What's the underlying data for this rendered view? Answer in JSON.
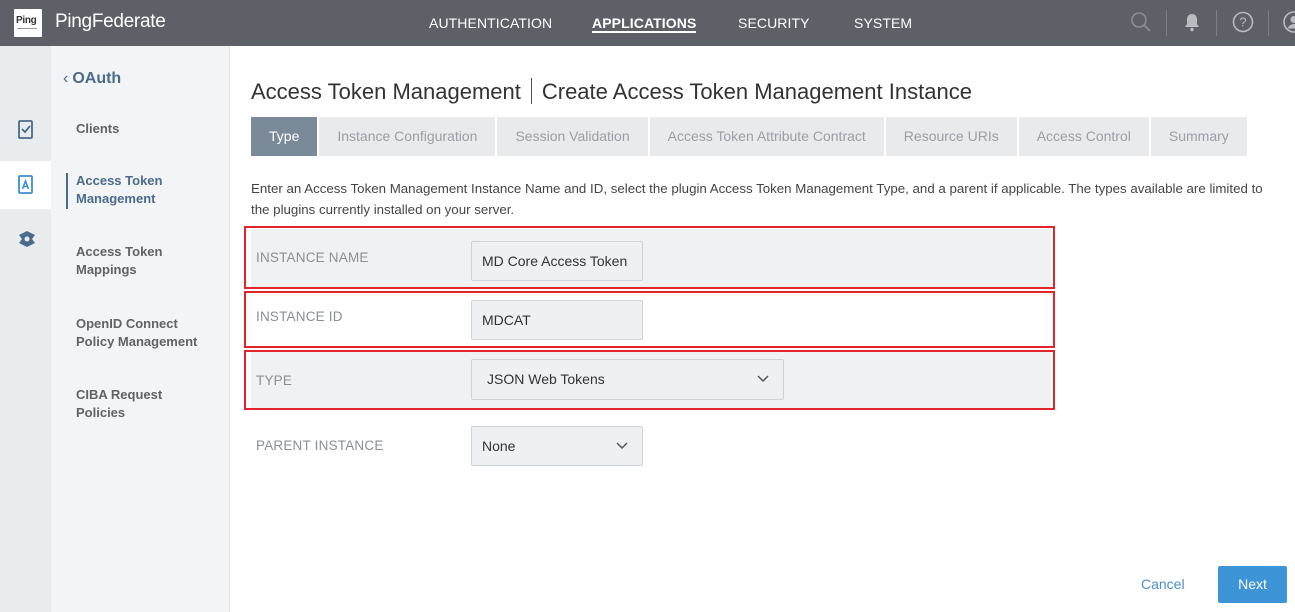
{
  "logo": {
    "mark": "Ping"
  },
  "header": {
    "brand": "PingFederate",
    "nav": [
      "AUTHENTICATION",
      "APPLICATIONS",
      "SECURITY",
      "SYSTEM"
    ],
    "active_nav": "APPLICATIONS",
    "icons": [
      "search-icon",
      "bell-icon",
      "help-icon",
      "user-icon"
    ]
  },
  "rail": {
    "icons": [
      "clients-icon",
      "token-icon",
      "policy-icon"
    ]
  },
  "sidebar": {
    "back_label": "OAuth",
    "items": [
      {
        "label": "Clients"
      },
      {
        "label": "Access Token Management"
      },
      {
        "label": "Access Token Mappings"
      },
      {
        "label": "OpenID Connect Policy Management"
      },
      {
        "label": "CIBA Request Policies"
      }
    ],
    "active_index": 1
  },
  "page": {
    "title_left": "Access Token Management",
    "title_right": "Create Access Token Management Instance",
    "tabs": [
      "Type",
      "Instance Configuration",
      "Session Validation",
      "Access Token Attribute Contract",
      "Resource URIs",
      "Access Control",
      "Summary"
    ],
    "active_tab": "Type",
    "description": "Enter an Access Token Management Instance Name and ID, select the plugin Access Token Management Type, and a parent if applicable. The types available are limited to the plugins currently installed on your server."
  },
  "form": {
    "instance_name": {
      "label": "INSTANCE NAME",
      "value": "MD Core Access Token"
    },
    "instance_id": {
      "label": "INSTANCE ID",
      "value": "MDCAT"
    },
    "type": {
      "label": "TYPE",
      "value": "JSON Web Tokens"
    },
    "parent": {
      "label": "PARENT INSTANCE",
      "value": "None"
    }
  },
  "footer": {
    "cancel_label": "Cancel",
    "next_label": "Next"
  },
  "colors": {
    "topbar": "#5d6167",
    "accent": "#4a6b8a",
    "primary_button": "#3d94d6",
    "highlight": "#e3242b"
  }
}
